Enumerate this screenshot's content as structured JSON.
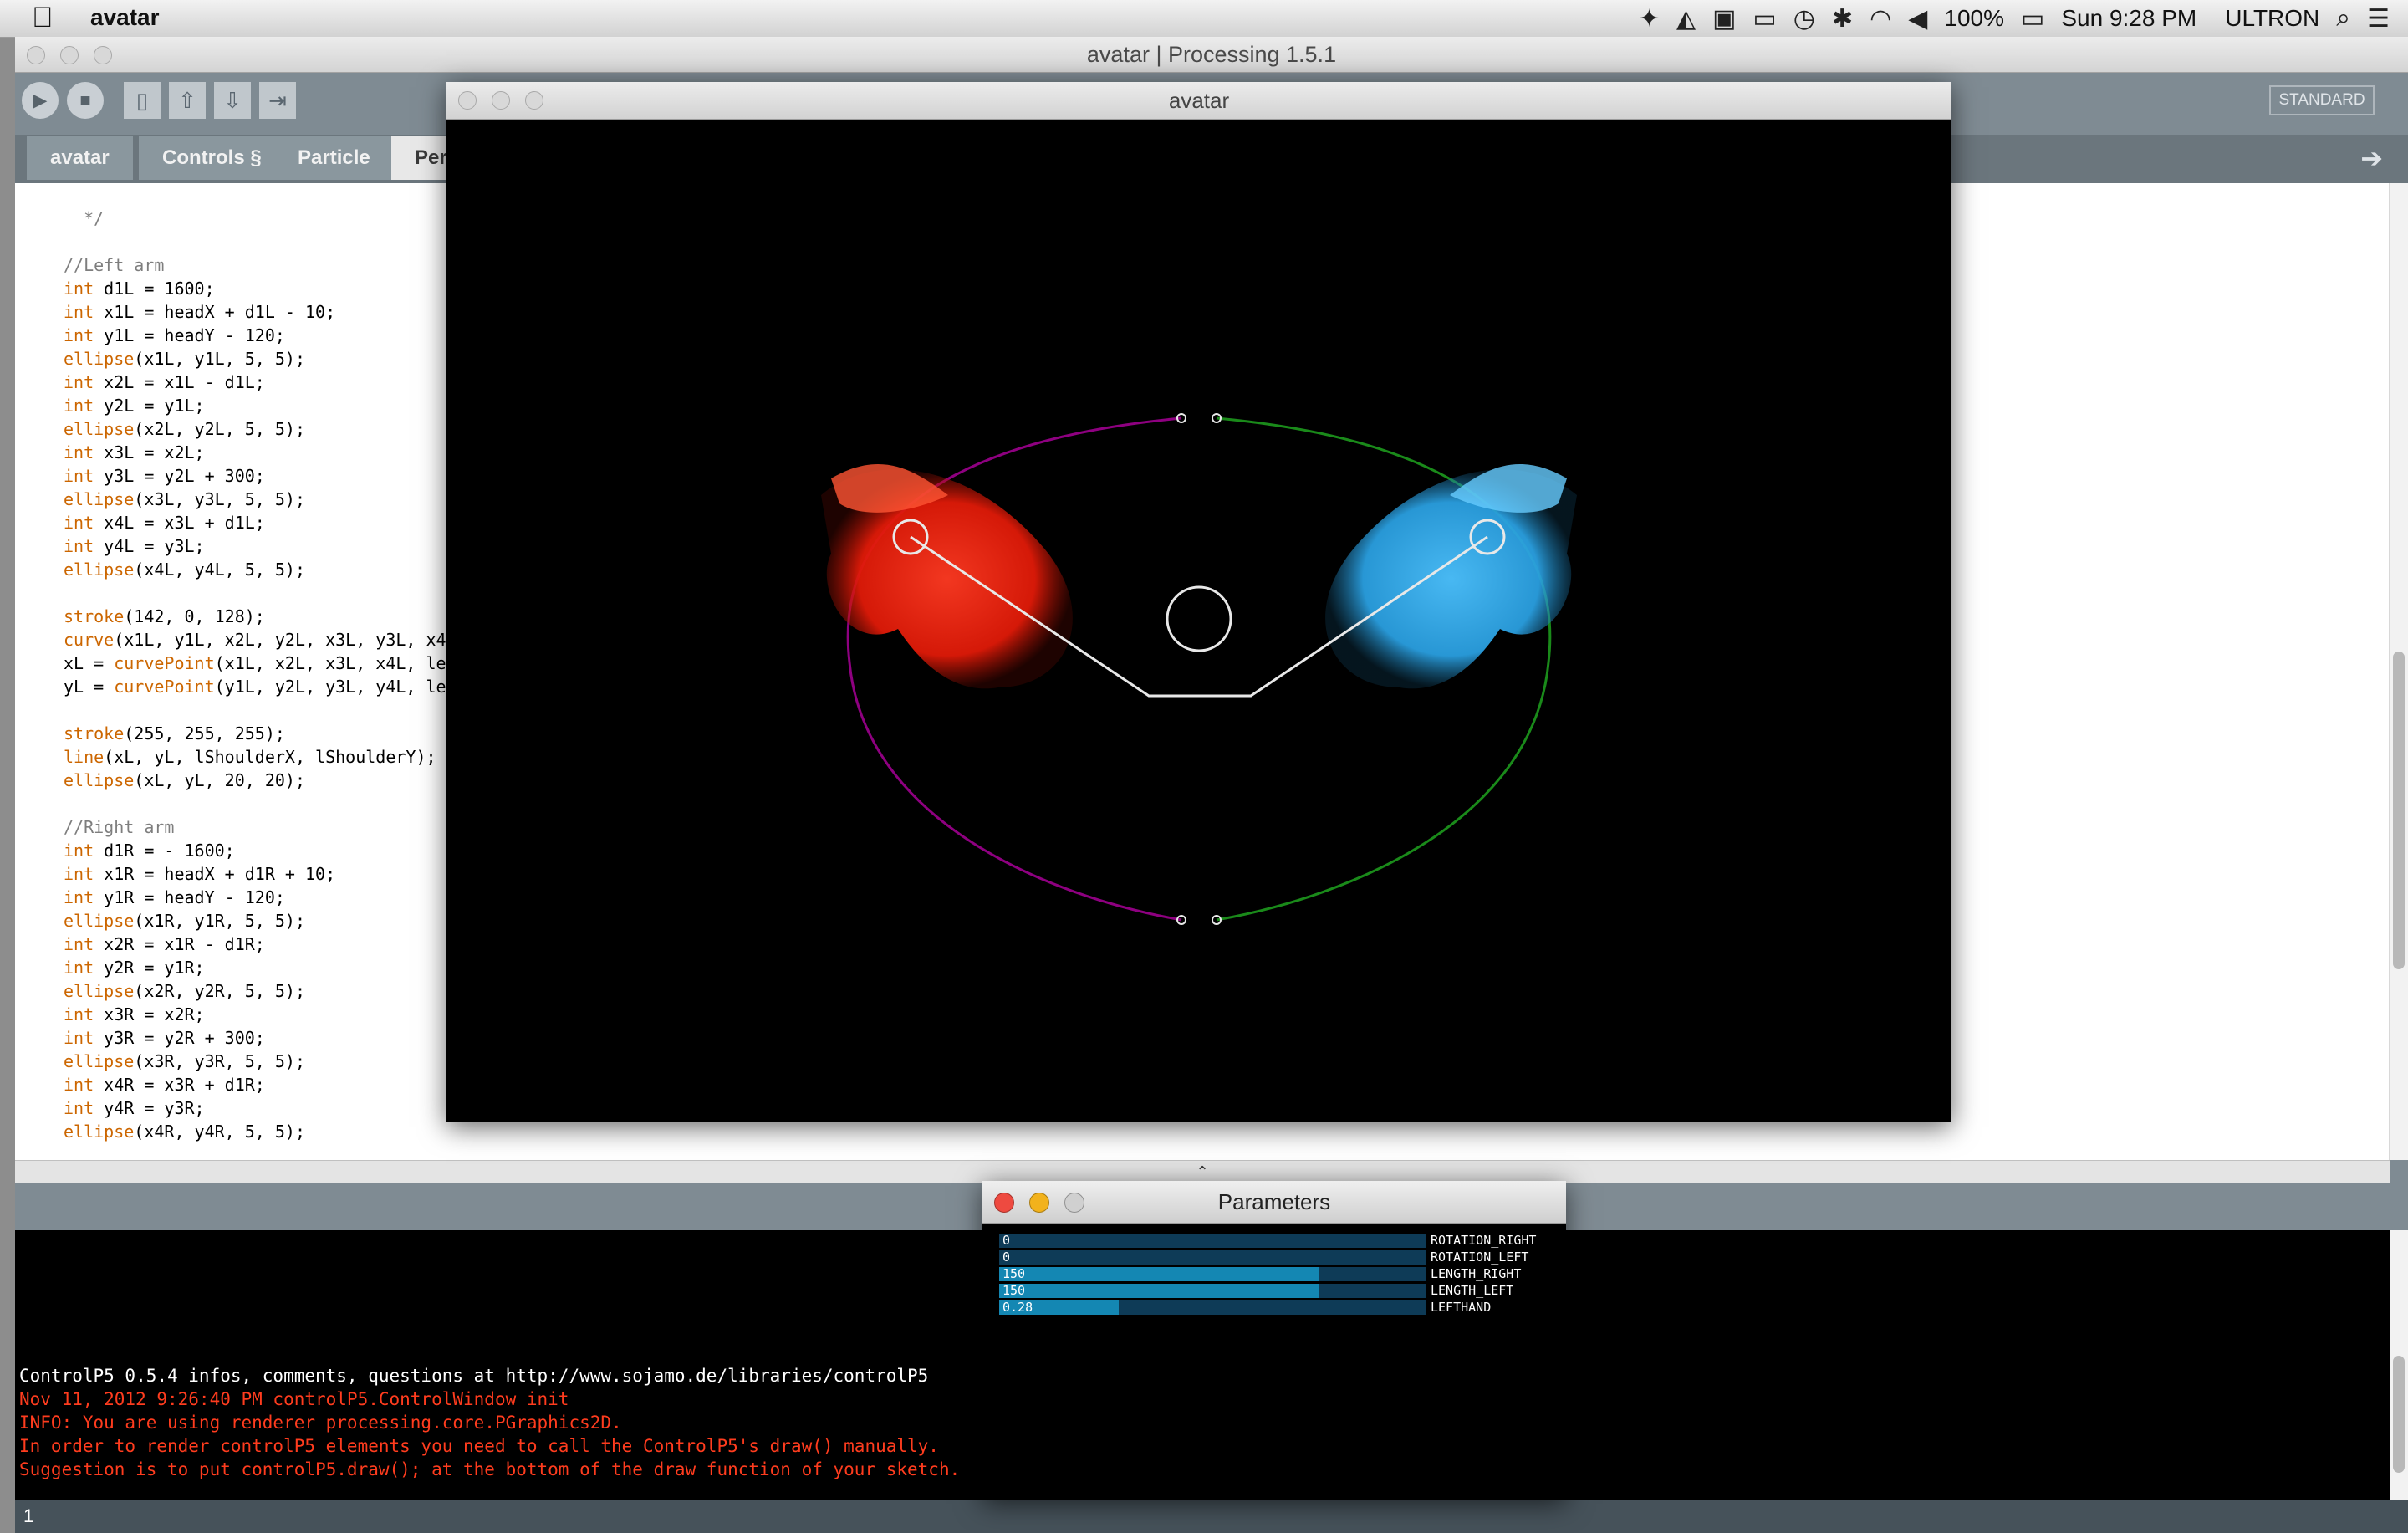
{
  "menubar": {
    "app_name": "avatar",
    "battery": "100%",
    "clock": "Sun 9:28 PM",
    "user": "ULTRON",
    "status_icons": [
      "dropbox-icon",
      "adobe-icon",
      "mirror-icon",
      "airplay-icon",
      "time-machine-icon",
      "bluetooth-icon",
      "wifi-icon",
      "volume-icon",
      "battery-icon"
    ]
  },
  "ide": {
    "title": "avatar | Processing 1.5.1",
    "mode": "STANDARD",
    "tabs": [
      "avatar",
      "Controls §",
      "Particle",
      "Pers"
    ],
    "code_lines": [
      "  */",
      "",
      "//Left arm",
      "int d1L = 1600;",
      "int x1L = headX + d1L - 10;",
      "int y1L = headY - 120;",
      "ellipse(x1L, y1L, 5, 5);",
      "int x2L = x1L - d1L;",
      "int y2L = y1L;",
      "ellipse(x2L, y2L, 5, 5);",
      "int x3L = x2L;",
      "int y3L = y2L + 300;",
      "ellipse(x3L, y3L, 5, 5);",
      "int x4L = x3L + d1L;",
      "int y4L = y3L;",
      "ellipse(x4L, y4L, 5, 5);",
      "",
      "stroke(142, 0, 128);",
      "curve(x1L, y1L, x2L, y2L, x3L, y3L, x4",
      "xL = curvePoint(x1L, x2L, x3L, x4L, le",
      "yL = curvePoint(y1L, y2L, y3L, y4L, le",
      "",
      "stroke(255, 255, 255);",
      "line(xL, yL, lShoulderX, lShoulderY);",
      "ellipse(xL, yL, 20, 20);",
      "",
      "//Right arm",
      "int d1R = - 1600;",
      "int x1R = headX + d1R + 10;",
      "int y1R = headY - 120;",
      "ellipse(x1R, y1R, 5, 5);",
      "int x2R = x1R - d1R;",
      "int y2R = y1R;",
      "ellipse(x2R, y2R, 5, 5);",
      "int x3R = x2R;",
      "int y3R = y2R + 300;",
      "ellipse(x3R, y3R, 5, 5);",
      "int x4R = x3R + d1R;",
      "int y4R = y3R;",
      "ellipse(x4R, y4R, 5, 5);"
    ],
    "console_lines": [
      {
        "text": "ControlP5 0.5.4 infos, comments, questions at http://www.sojamo.de/libraries/controlP5",
        "color": "#ffffff"
      },
      {
        "text": "Nov 11, 2012 9:26:40 PM controlP5.ControlWindow init",
        "color": "#ff3c1e"
      },
      {
        "text": "INFO: You are using renderer processing.core.PGraphics2D.",
        "color": "#ff3c1e"
      },
      {
        "text": "In order to render controlP5 elements you need to call the ControlP5's draw() manually.",
        "color": "#ff3c1e"
      },
      {
        "text": "Suggestion is to put controlP5.draw(); at the bottom of the draw function of your sketch.",
        "color": "#ff3c1e"
      }
    ],
    "line_number": "1"
  },
  "sketch_window": {
    "title": "avatar"
  },
  "parameters_window": {
    "title": "Parameters",
    "sliders": [
      {
        "label": "ROTATION_RIGHT",
        "value": "0",
        "fraction": 0.0
      },
      {
        "label": "ROTATION_LEFT",
        "value": "0",
        "fraction": 0.0
      },
      {
        "label": "LENGTH_RIGHT",
        "value": "150",
        "fraction": 0.75
      },
      {
        "label": "LENGTH_LEFT",
        "value": "150",
        "fraction": 0.75
      },
      {
        "label": "LEFTHAND",
        "value": "0.28",
        "fraction": 0.28
      }
    ]
  },
  "colors": {
    "left_particles": "#ff2a14",
    "right_particles": "#3cb4f0",
    "left_curve": "#8e0080",
    "right_curve": "#1a8a1a",
    "skeleton": "#ffffff",
    "slider_fill": "#1487b3",
    "slider_track": "#0e3b57"
  }
}
